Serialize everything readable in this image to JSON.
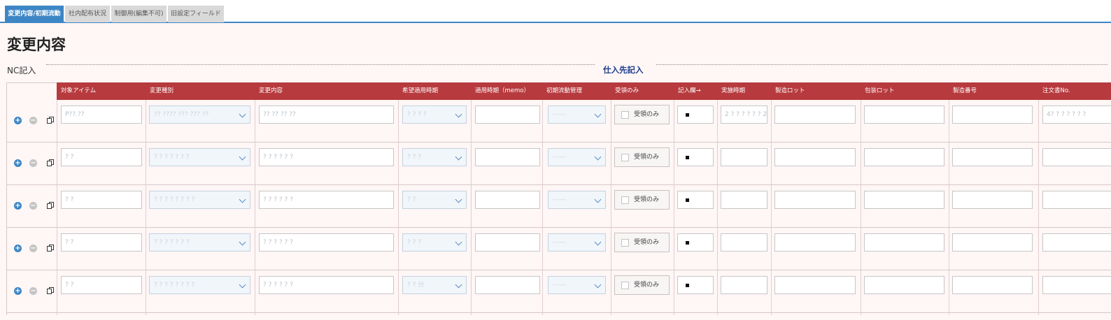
{
  "tabs": [
    {
      "label": "変更内容/初期流動",
      "active": true
    },
    {
      "label": "社内配布状況",
      "active": false
    },
    {
      "label": "制御用(編集不可)",
      "active": false
    },
    {
      "label": "旧設定フィールド",
      "active": false
    }
  ],
  "page_title": "変更内容",
  "nc_label": "NC記入",
  "supplier_label": "仕入先記入",
  "columns": [
    "対象アイテム",
    "変更種別",
    "変更内容",
    "希望適用時期",
    "適用時期（memo）",
    "初期流動管理",
    "受領のみ",
    "記入欄→",
    "実施時期",
    "製造ロット",
    "包装ロット",
    "製造番号",
    "注文書No."
  ],
  "checkbox_label": "受領のみ",
  "initial_flow_placeholder": "------",
  "rows": [
    {
      "item": "P??.?? ",
      "change_type": "?? ???? ??? ??? ??",
      "content": "?? ?? ?? ??",
      "period": "? ? ? ?",
      "impl_date": "2 ? ? ? ? ? ? 2",
      "order_no": "4? ? ? ? ? ? ?"
    },
    {
      "item": "? ?",
      "change_type": "? ? ? ? ? ? ?",
      "content": "? ? ? ? ? ?",
      "period": "? ? ?",
      "impl_date": "",
      "order_no": ""
    },
    {
      "item": "? ?",
      "change_type": "? ? ? ? ? ? ? ?",
      "content": "? ? ? ? ? ?",
      "period": "? ?",
      "impl_date": "",
      "order_no": ""
    },
    {
      "item": "? ?",
      "change_type": "? ? ? ? ? ? ?",
      "content": "? ? ? ? ? ?",
      "period": "? ? ?",
      "impl_date": "",
      "order_no": ""
    },
    {
      "item": "? ?",
      "change_type": "? ? ? ? ? ? ? ?",
      "content": "? ? ? ? ? ?",
      "period": "? ? 分",
      "impl_date": "",
      "order_no": ""
    }
  ]
}
